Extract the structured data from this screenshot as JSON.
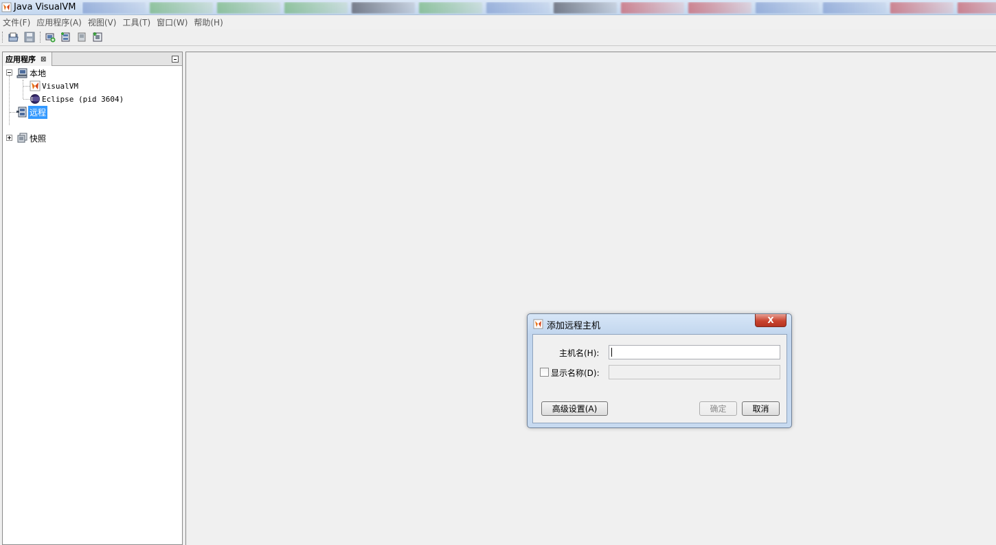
{
  "window": {
    "title": "Java VisualVM"
  },
  "menu": [
    {
      "label": "文件(F)"
    },
    {
      "label": "应用程序(A)"
    },
    {
      "label": "视图(V)"
    },
    {
      "label": "工具(T)"
    },
    {
      "label": "窗口(W)"
    },
    {
      "label": "帮助(H)"
    }
  ],
  "toolbar": {
    "buttons": [
      "open-file-icon",
      "save-icon",
      "add-jmx-connection-icon",
      "add-remote-host-icon",
      "add-snapshot-icon",
      "add-core-dump-icon"
    ]
  },
  "left_panel": {
    "tab_label": "应用程序",
    "close_glyph": "⊠",
    "tree": [
      {
        "label": "本地",
        "icon": "local-computer-icon",
        "expanded": true
      },
      {
        "label": "VisualVM",
        "icon": "visualvm-icon"
      },
      {
        "label": "Eclipse (pid 3604)",
        "icon": "eclipse-icon"
      },
      {
        "label": "远程",
        "icon": "remote-host-icon",
        "selected": true
      },
      {
        "label": "快照",
        "icon": "snapshot-icon",
        "expanded": false
      }
    ]
  },
  "dialog": {
    "title": "添加远程主机",
    "close_label": "X",
    "hostname_label": "主机名(H):",
    "hostname_value": "",
    "display_name_label": "显示名称(D):",
    "display_name_checked": false,
    "display_name_value": "",
    "advanced_button": "高级设置(A)",
    "ok_button": "确定",
    "cancel_button": "取消"
  },
  "colors": {
    "selection": "#3399ff",
    "close_button": "#c9442f"
  }
}
